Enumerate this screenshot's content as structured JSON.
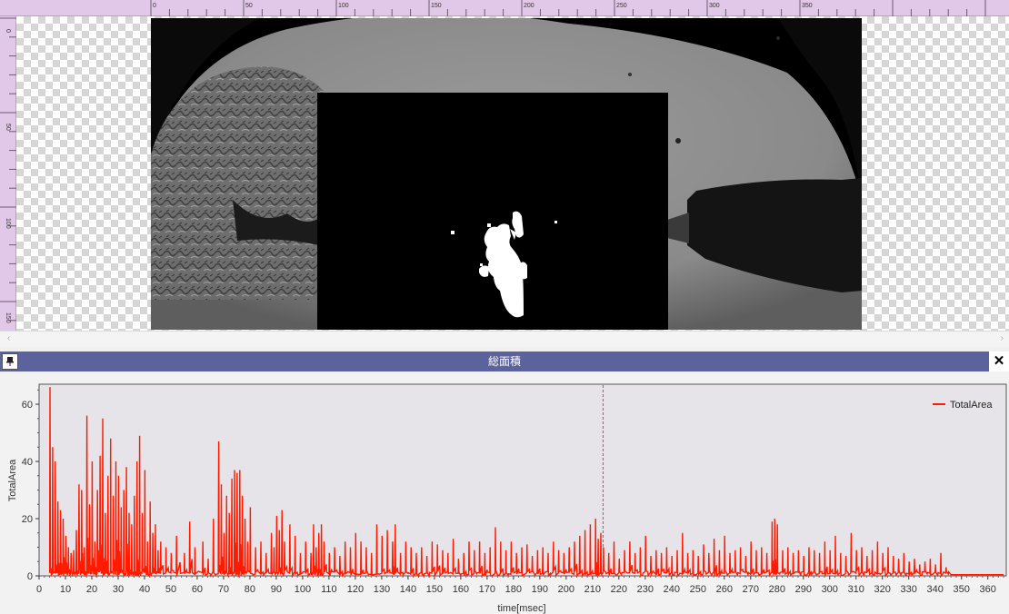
{
  "ruler": {
    "top_ticks": [
      "0",
      "50",
      "100",
      "150",
      "200",
      "250",
      "300",
      "350"
    ],
    "left_ticks": [
      "0",
      "50",
      "100",
      "150"
    ]
  },
  "viewer": {
    "image": "high-speed camera frame with binarized region of interest",
    "colors": {
      "ruler": "#e2c8e8",
      "overlay": "#000000",
      "blob": "#ffffff"
    }
  },
  "panel": {
    "title": "総面積",
    "close_label": "✕",
    "pin_icon": "pin-icon",
    "titlebar_color": "#5c629c"
  },
  "chart_data": {
    "type": "line",
    "title": "",
    "xlabel": "time[msec]",
    "ylabel": "TotalArea",
    "xlim": [
      0,
      367
    ],
    "ylim": [
      0,
      67
    ],
    "x_ticks": [
      0,
      10,
      20,
      30,
      40,
      50,
      60,
      70,
      80,
      90,
      100,
      110,
      120,
      130,
      140,
      150,
      160,
      170,
      180,
      190,
      200,
      210,
      220,
      230,
      240,
      250,
      260,
      270,
      280,
      290,
      300,
      310,
      320,
      330,
      340,
      350,
      360
    ],
    "y_ticks": [
      0,
      20,
      40,
      60
    ],
    "legend": "top-right",
    "grid": false,
    "marker_x": 214,
    "series": [
      {
        "name": "TotalArea",
        "color": "#ff1a00",
        "peaks": [
          [
            4,
            66
          ],
          [
            5,
            45
          ],
          [
            6,
            40
          ],
          [
            7,
            26
          ],
          [
            8,
            23
          ],
          [
            9,
            20
          ],
          [
            10,
            14
          ],
          [
            11,
            10
          ],
          [
            12,
            8
          ],
          [
            13,
            9
          ],
          [
            14,
            16
          ],
          [
            15,
            32
          ],
          [
            16,
            30
          ],
          [
            17,
            10
          ],
          [
            18,
            56
          ],
          [
            19,
            25
          ],
          [
            20,
            40
          ],
          [
            21,
            12
          ],
          [
            22,
            30
          ],
          [
            23,
            42
          ],
          [
            24,
            55
          ],
          [
            25,
            22
          ],
          [
            26,
            35
          ],
          [
            27,
            48
          ],
          [
            28,
            28
          ],
          [
            29,
            40
          ],
          [
            30,
            35
          ],
          [
            31,
            24
          ],
          [
            32,
            30
          ],
          [
            33,
            38
          ],
          [
            34,
            22
          ],
          [
            35,
            18
          ],
          [
            36,
            28
          ],
          [
            37,
            40
          ],
          [
            38,
            49
          ],
          [
            39,
            22
          ],
          [
            40,
            37
          ],
          [
            41,
            12
          ],
          [
            42,
            26
          ],
          [
            43,
            15
          ],
          [
            44,
            18
          ],
          [
            45,
            9
          ],
          [
            46,
            12
          ],
          [
            48,
            10
          ],
          [
            50,
            8
          ],
          [
            52,
            14
          ],
          [
            55,
            8
          ],
          [
            57,
            19
          ],
          [
            59,
            10
          ],
          [
            62,
            12
          ],
          [
            64,
            6
          ],
          [
            66,
            20
          ],
          [
            68,
            47
          ],
          [
            69,
            32
          ],
          [
            70,
            15
          ],
          [
            71,
            28
          ],
          [
            72,
            22
          ],
          [
            73,
            34
          ],
          [
            74,
            37
          ],
          [
            75,
            36
          ],
          [
            76,
            37
          ],
          [
            77,
            28
          ],
          [
            78,
            20
          ],
          [
            79,
            12
          ],
          [
            80,
            24
          ],
          [
            82,
            10
          ],
          [
            84,
            12
          ],
          [
            86,
            8
          ],
          [
            88,
            15
          ],
          [
            89,
            10
          ],
          [
            90,
            21
          ],
          [
            91,
            16
          ],
          [
            92,
            23
          ],
          [
            93,
            12
          ],
          [
            95,
            18
          ],
          [
            97,
            14
          ],
          [
            99,
            8
          ],
          [
            101,
            12
          ],
          [
            103,
            8
          ],
          [
            104,
            18
          ],
          [
            105,
            10
          ],
          [
            106,
            15
          ],
          [
            107,
            18
          ],
          [
            108,
            12
          ],
          [
            110,
            8
          ],
          [
            112,
            10
          ],
          [
            114,
            7
          ],
          [
            116,
            12
          ],
          [
            118,
            10
          ],
          [
            120,
            15
          ],
          [
            122,
            12
          ],
          [
            124,
            10
          ],
          [
            126,
            8
          ],
          [
            128,
            18
          ],
          [
            130,
            14
          ],
          [
            132,
            16
          ],
          [
            134,
            12
          ],
          [
            135,
            18
          ],
          [
            137,
            8
          ],
          [
            139,
            12
          ],
          [
            141,
            10
          ],
          [
            143,
            8
          ],
          [
            145,
            10
          ],
          [
            147,
            7
          ],
          [
            149,
            12
          ],
          [
            151,
            11
          ],
          [
            153,
            9
          ],
          [
            155,
            8
          ],
          [
            157,
            13
          ],
          [
            159,
            6
          ],
          [
            161,
            8
          ],
          [
            163,
            12
          ],
          [
            165,
            9
          ],
          [
            167,
            12
          ],
          [
            169,
            8
          ],
          [
            171,
            10
          ],
          [
            173,
            17
          ],
          [
            175,
            12
          ],
          [
            177,
            9
          ],
          [
            179,
            12
          ],
          [
            181,
            8
          ],
          [
            183,
            10
          ],
          [
            185,
            11
          ],
          [
            187,
            7
          ],
          [
            189,
            9
          ],
          [
            191,
            10
          ],
          [
            193,
            8
          ],
          [
            195,
            12
          ],
          [
            197,
            9
          ],
          [
            199,
            8
          ],
          [
            201,
            10
          ],
          [
            203,
            12
          ],
          [
            205,
            14
          ],
          [
            207,
            16
          ],
          [
            209,
            18
          ],
          [
            211,
            20
          ],
          [
            212,
            13
          ],
          [
            213,
            15
          ],
          [
            214,
            10
          ],
          [
            216,
            8
          ],
          [
            218,
            12
          ],
          [
            220,
            6
          ],
          [
            222,
            9
          ],
          [
            224,
            12
          ],
          [
            226,
            8
          ],
          [
            228,
            10
          ],
          [
            230,
            14
          ],
          [
            232,
            7
          ],
          [
            234,
            9
          ],
          [
            236,
            8
          ],
          [
            238,
            10
          ],
          [
            240,
            7
          ],
          [
            242,
            9
          ],
          [
            244,
            15
          ],
          [
            246,
            8
          ],
          [
            248,
            9
          ],
          [
            250,
            7
          ],
          [
            252,
            11
          ],
          [
            254,
            8
          ],
          [
            256,
            13
          ],
          [
            258,
            9
          ],
          [
            260,
            14
          ],
          [
            262,
            8
          ],
          [
            264,
            9
          ],
          [
            266,
            10
          ],
          [
            268,
            7
          ],
          [
            270,
            12
          ],
          [
            272,
            9
          ],
          [
            274,
            10
          ],
          [
            276,
            8
          ],
          [
            278,
            19
          ],
          [
            279,
            20
          ],
          [
            280,
            18
          ],
          [
            282,
            9
          ],
          [
            284,
            10
          ],
          [
            286,
            8
          ],
          [
            288,
            9
          ],
          [
            290,
            7
          ],
          [
            292,
            10
          ],
          [
            294,
            9
          ],
          [
            296,
            8
          ],
          [
            298,
            12
          ],
          [
            300,
            9
          ],
          [
            302,
            14
          ],
          [
            304,
            8
          ],
          [
            306,
            7
          ],
          [
            308,
            15
          ],
          [
            310,
            9
          ],
          [
            312,
            10
          ],
          [
            314,
            7
          ],
          [
            316,
            9
          ],
          [
            318,
            12
          ],
          [
            320,
            8
          ],
          [
            322,
            10
          ],
          [
            324,
            7
          ],
          [
            326,
            6
          ],
          [
            328,
            8
          ],
          [
            330,
            5
          ],
          [
            332,
            6
          ],
          [
            334,
            4
          ],
          [
            336,
            5
          ],
          [
            338,
            6
          ],
          [
            340,
            4
          ],
          [
            342,
            8
          ],
          [
            344,
            3
          ]
        ]
      }
    ]
  }
}
